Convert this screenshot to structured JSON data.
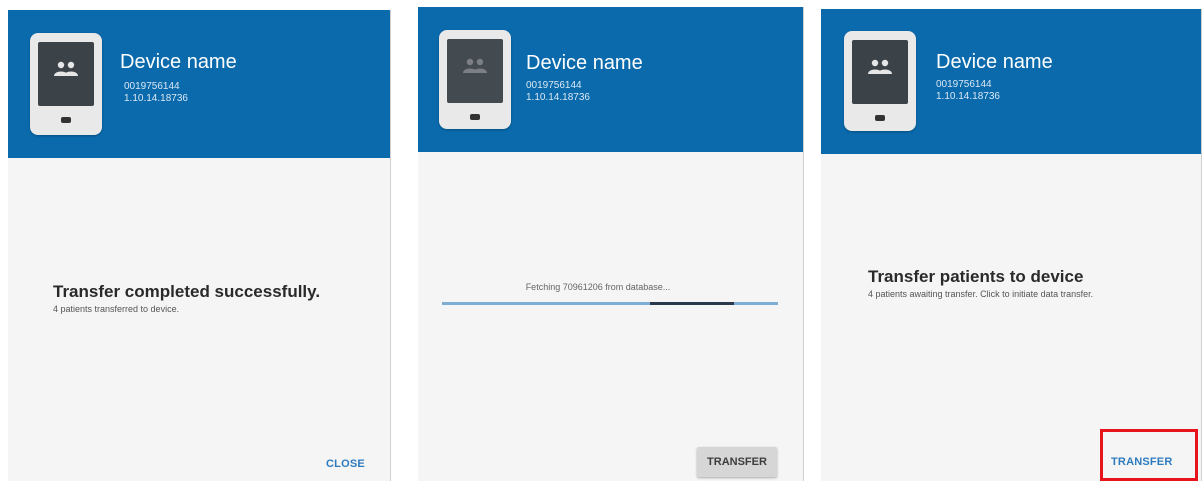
{
  "panels": [
    {
      "header": {
        "device_name": "Device name",
        "serial": "0019756144",
        "version": "1.10.14.18736"
      },
      "title": "Transfer completed successfully.",
      "subtitle": "4 patients transferred to device.",
      "button": "CLOSE"
    },
    {
      "header": {
        "device_name": "Device name",
        "serial": "0019756144",
        "version": "1.10.14.18736"
      },
      "status_text": "Fetching 70961206 from database...",
      "progress": 0.62,
      "button": "TRANSFER"
    },
    {
      "header": {
        "device_name": "Device name",
        "serial": "0019756144",
        "version": "1.10.14.18736"
      },
      "title": "Transfer patients to device",
      "subtitle": "4 patients awaiting transfer. Click to initiate data transfer.",
      "button": "TRANSFER"
    }
  ],
  "colors": {
    "header_bg": "#0a6aac",
    "accent": "#2d7bbf",
    "highlight": "#e8141c"
  },
  "icons": {
    "device": "tablet-device-icon",
    "patients": "people-icon"
  }
}
